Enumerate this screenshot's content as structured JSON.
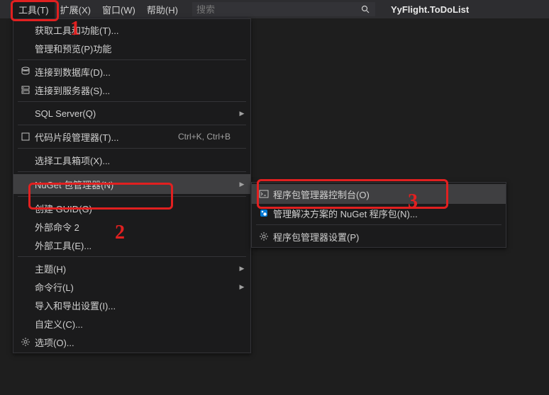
{
  "menubar": {
    "tools": "工具(T)",
    "ext": "扩展(X)",
    "window": "窗口(W)",
    "help": "帮助(H)"
  },
  "search": {
    "placeholder": "搜索"
  },
  "project_name": "YyFlight.ToDoList",
  "tools_menu": {
    "get_tools": "获取工具和功能(T)...",
    "manage_preview": "管理和预览(P)功能",
    "connect_db": "连接到数据库(D)...",
    "connect_server": "连接到服务器(S)...",
    "sql_server": "SQL Server(Q)",
    "snippet_mgr": "代码片段管理器(T)...",
    "snippet_shortcut": "Ctrl+K, Ctrl+B",
    "choose_toolbox": "选择工具箱项(X)...",
    "nuget": "NuGet 包管理器(N)",
    "create_guid": "创建 GUID(G)",
    "ext_cmd2": "外部命令 2",
    "ext_tools": "外部工具(E)...",
    "theme": "主题(H)",
    "cmdline": "命令行(L)",
    "import_export": "导入和导出设置(I)...",
    "customize": "自定义(C)...",
    "options": "选项(O)..."
  },
  "nuget_submenu": {
    "pm_console": "程序包管理器控制台(O)",
    "manage_pkgs": "管理解决方案的 NuGet 程序包(N)...",
    "pm_settings": "程序包管理器设置(P)"
  },
  "annotations": {
    "n1": "1",
    "n2": "2",
    "n3": "3"
  }
}
